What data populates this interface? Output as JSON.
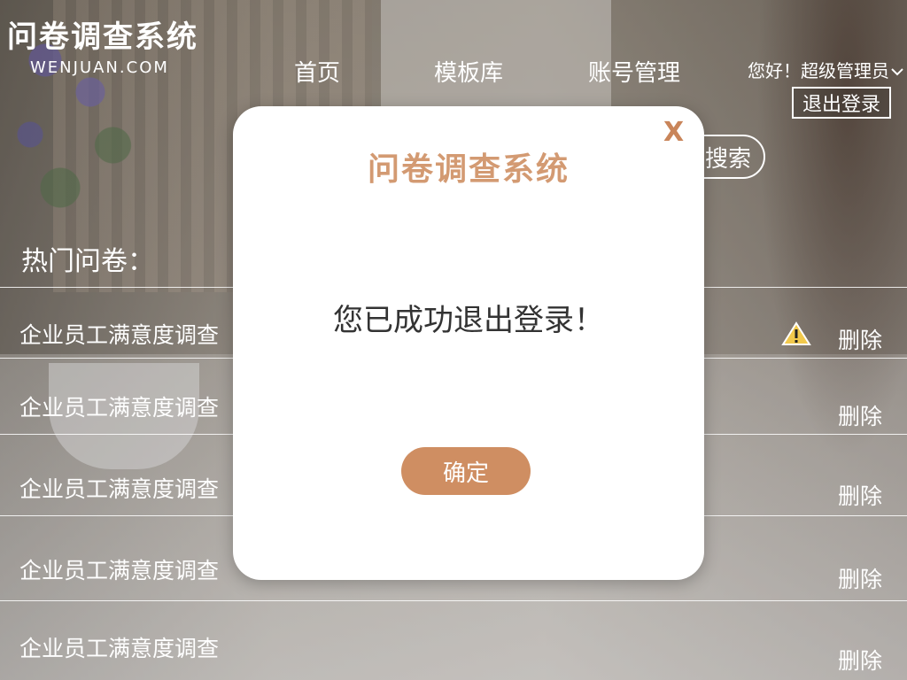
{
  "header": {
    "logo_title": "问卷调查系统",
    "logo_subtitle": "WENJUAN.COM",
    "nav": {
      "home": "首页",
      "templates": "模板库",
      "account": "账号管理"
    },
    "user_greeting": "您好！超级管理员",
    "logout_label": "退出登录",
    "search_label": "搜索"
  },
  "hot": {
    "title": "热门问卷：",
    "items": [
      {
        "name": "企业员工满意度调查",
        "action": "删除"
      },
      {
        "name": "企业员工满意度调查",
        "action": "删除"
      },
      {
        "name": "企业员工满意度调查",
        "action": "删除"
      },
      {
        "name": "企业员工满意度调查",
        "action": "删除"
      },
      {
        "name": "企业员工满意度调查",
        "action": "删除"
      }
    ]
  },
  "modal": {
    "close_label": "X",
    "title": "问卷调查系统",
    "message": "您已成功退出登录！",
    "confirm_label": "确定"
  },
  "colors": {
    "accent": "#cf8e62",
    "title_accent": "#d39a72",
    "close_accent": "#c9855a",
    "warning": "#f2c94c"
  },
  "icons": {
    "warning": "warning-icon",
    "chevron": "chevron-down-icon"
  }
}
